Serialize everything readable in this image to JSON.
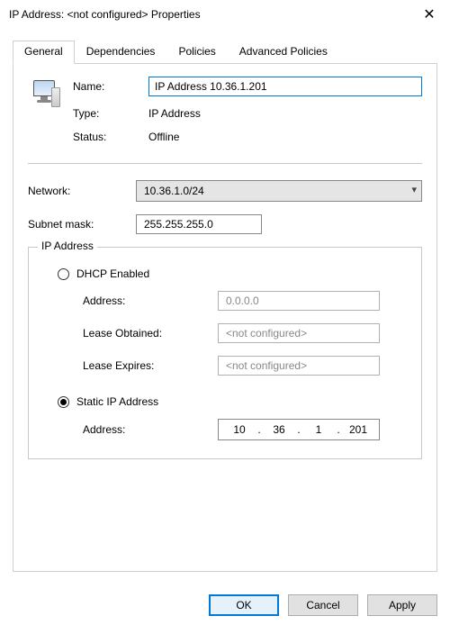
{
  "window": {
    "title": "IP Address: <not configured> Properties",
    "close_glyph": "✕"
  },
  "tabs": {
    "general": "General",
    "dependencies": "Dependencies",
    "policies": "Policies",
    "advanced": "Advanced Policies"
  },
  "general": {
    "labels": {
      "name": "Name:",
      "type": "Type:",
      "status": "Status:"
    },
    "name_value": "IP Address 10.36.1.201",
    "type_value": "IP Address",
    "status_value": "Offline"
  },
  "network": {
    "label": "Network:",
    "value": "10.36.1.0/24"
  },
  "subnet": {
    "label": "Subnet mask:",
    "value": "255.255.255.0"
  },
  "ipgroup": {
    "legend": "IP Address",
    "dhcp": {
      "label": "DHCP Enabled",
      "address_label": "Address:",
      "address_value": "0.0.0.0",
      "lease_obtained_label": "Lease Obtained:",
      "lease_obtained_value": "<not configured>",
      "lease_expires_label": "Lease Expires:",
      "lease_expires_value": "<not configured>"
    },
    "static": {
      "label": "Static IP Address",
      "address_label": "Address:",
      "oct1": "10",
      "oct2": "36",
      "oct3": "1",
      "oct4": "201"
    }
  },
  "buttons": {
    "ok": "OK",
    "cancel": "Cancel",
    "apply": "Apply"
  }
}
